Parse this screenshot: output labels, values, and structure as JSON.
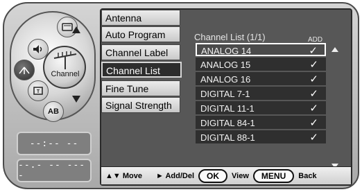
{
  "dial": {
    "center_label": "Channel",
    "buttons": [
      {
        "name": "picture-icon",
        "glyph": "▭"
      },
      {
        "name": "speaker-icon",
        "glyph": "🔈"
      },
      {
        "name": "antenna-icon",
        "glyph": "ꭥ"
      },
      {
        "name": "lock-icon",
        "glyph": "🔒"
      },
      {
        "name": "ab-button",
        "glyph": "AB"
      }
    ]
  },
  "clock": {
    "time": "--:-- --",
    "date": "--.- -- ----"
  },
  "menu": [
    {
      "label": "Antenna"
    },
    {
      "label": "Auto Program"
    },
    {
      "label": "Channel Label"
    },
    {
      "label": "Channel List",
      "active": true
    },
    {
      "label": "Fine Tune"
    },
    {
      "label": "Signal Strength"
    }
  ],
  "channel_list": {
    "title": "Channel List (1/1)",
    "add_header": "ADD",
    "check_glyph": "✓",
    "rows": [
      {
        "name": "ANALOG 14",
        "added": true,
        "selected": true
      },
      {
        "name": "ANALOG 15",
        "added": true
      },
      {
        "name": "ANALOG 16",
        "added": true
      },
      {
        "name": "DIGITAL 7-1",
        "added": true
      },
      {
        "name": "DIGITAL 11-1",
        "added": true
      },
      {
        "name": "DIGITAL 84-1",
        "added": true
      },
      {
        "name": "DIGITAL 88-1",
        "added": true
      }
    ]
  },
  "footer": {
    "move": "▲▼ Move",
    "add_del": "► Add/Del",
    "ok_key": "OK",
    "view": "View",
    "menu_key": "MENU",
    "back": "Back"
  }
}
